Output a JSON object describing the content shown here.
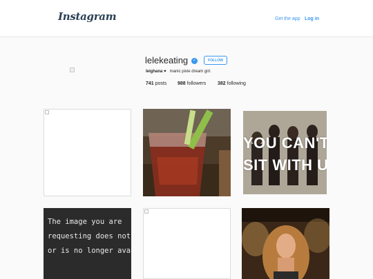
{
  "header": {
    "logo": "Instagram",
    "get_app": "Get the app",
    "login": "Log in"
  },
  "profile": {
    "username": "lelekeating",
    "verified_icon": "verified-check-icon",
    "follow_label": "FOLLOW",
    "bio_name": "leighana",
    "bio_heart": "♥",
    "bio_text": "manic pixie dream girl.",
    "stats": {
      "posts_count": "741",
      "posts_label": "posts",
      "followers_count": "988",
      "followers_label": "followers",
      "following_count": "382",
      "following_label": "following"
    }
  },
  "grid": {
    "band_line1": "YOU CAN'T",
    "band_line2": "SIT WITH US",
    "error_lines": [
      "The image you are",
      "requesting does not exist",
      "or is no longer available."
    ]
  },
  "colors": {
    "accent": "#3897f0",
    "text": "#262626",
    "background": "#fafafa"
  }
}
